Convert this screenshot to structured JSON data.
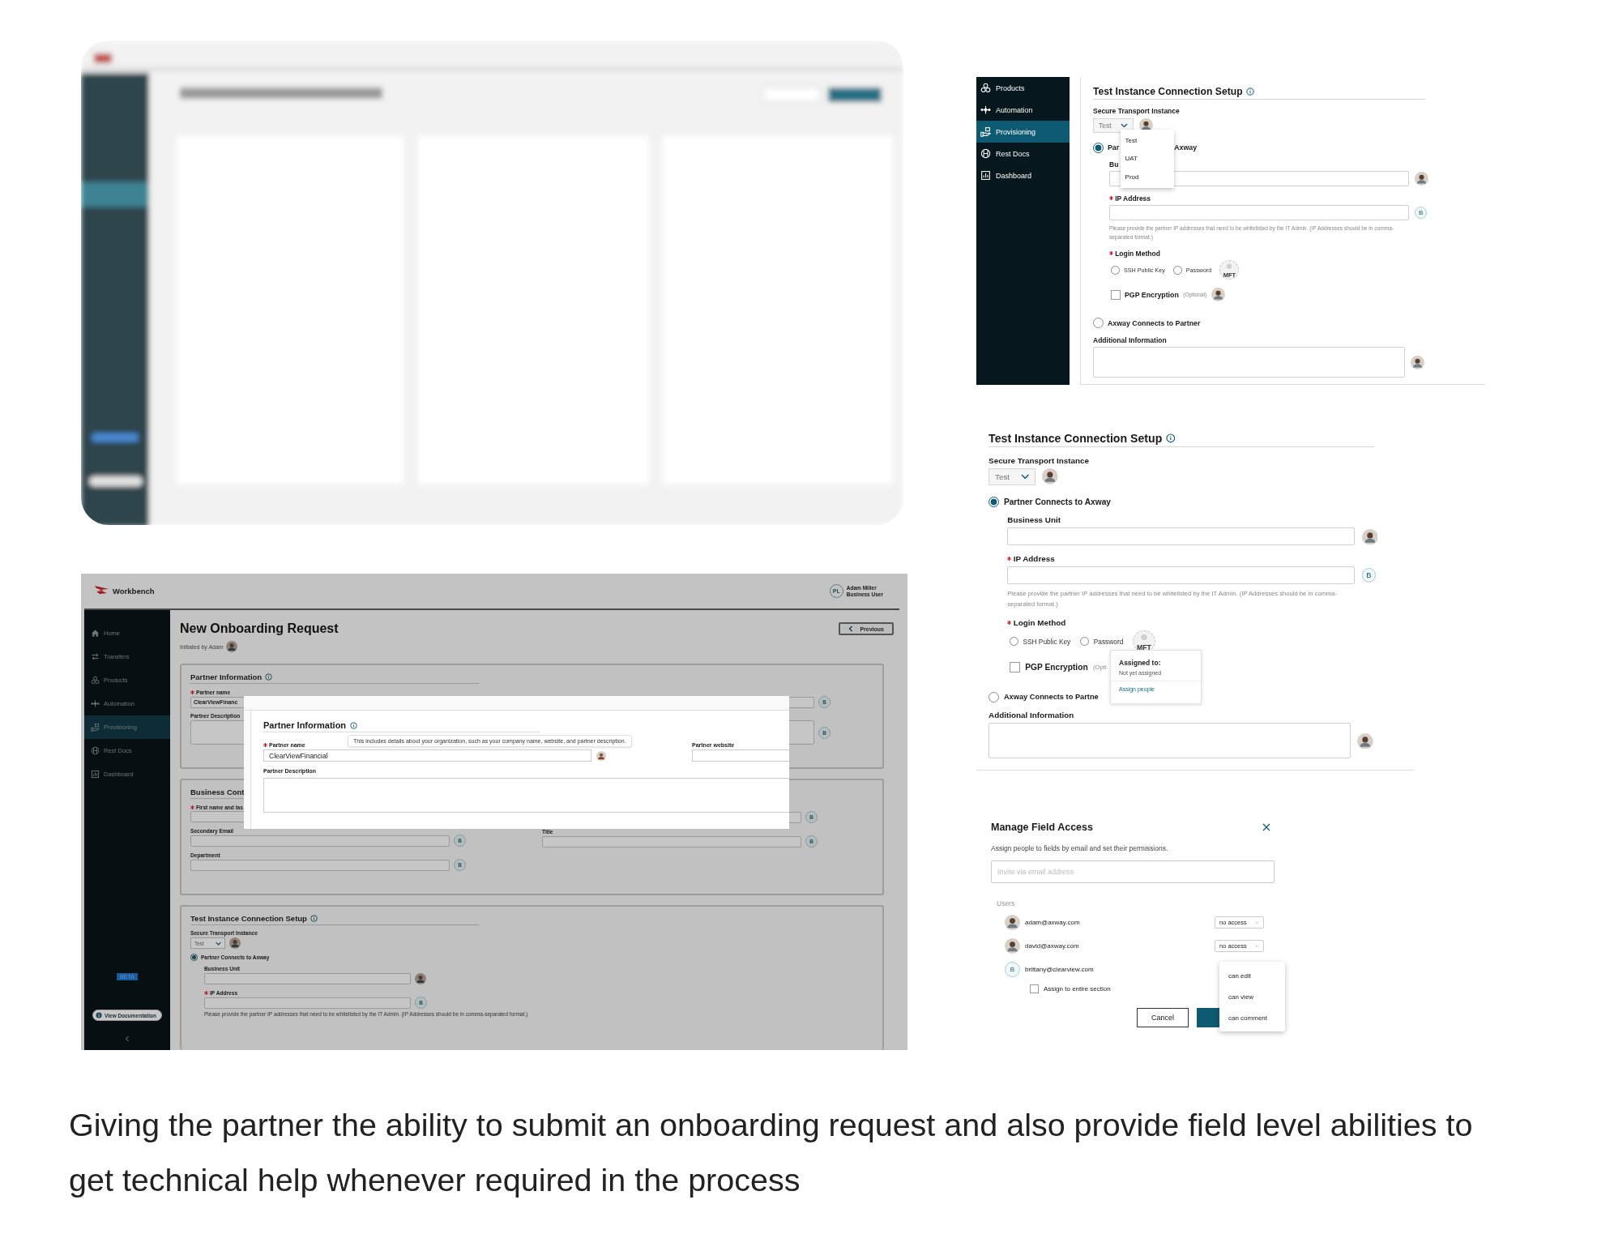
{
  "request_screen": {
    "brand": "Workbench",
    "user": {
      "initials": "PL",
      "name": "Adam Miller",
      "role": "Business User"
    },
    "nav": [
      {
        "label": "Home",
        "selected": false
      },
      {
        "label": "Transfers",
        "selected": false
      },
      {
        "label": "Products",
        "selected": false
      },
      {
        "label": "Automation",
        "selected": false
      },
      {
        "label": "Provisioning",
        "selected": true
      },
      {
        "label": "Rest Docs",
        "selected": false
      },
      {
        "label": "Dashboard",
        "selected": false
      }
    ],
    "badge": "BETA",
    "doc_button": "View Documentation",
    "title": "New Onboarding Request",
    "initiated": "Initiated by Adam",
    "previous": "Previous",
    "partner_card": {
      "title": "Partner Information",
      "name_label": {
        "text": "Partner name",
        "required": true
      },
      "name_value": "ClearViewFinanc",
      "name_assignee": "B",
      "desc_label": "Partner Description",
      "desc_assignee": "B"
    },
    "contact_card": {
      "title": "Business Cont",
      "fields_left": [
        {
          "label": "First name and las",
          "required": true
        },
        {
          "label": "Secondary Email",
          "assignee": "B"
        },
        {
          "label": "Department",
          "assignee": "B"
        }
      ],
      "fields_right": [
        {
          "assignee": "B"
        },
        {
          "label": "Title",
          "assignee": "B"
        }
      ]
    },
    "test_card": {
      "title": "Test Instance Connection Setup",
      "instance_label": "Secure Transport Instance",
      "instance_value": "Test",
      "option": {
        "label": "Partner Connects to Axway",
        "selected": true
      },
      "unit_label": "Business Unit",
      "ip_label": {
        "text": "IP Address",
        "required": true
      },
      "assignee": "B",
      "help": "Please provide the partner IP addresses that need to be whitelisted by the IT Admin. (IP Addresses should be in comma-separated format.)"
    },
    "modal": {
      "title": "Partner Information",
      "name_label": {
        "text": "Partner name",
        "required": true
      },
      "name_value": "ClearViewFinancial",
      "tooltip": "This includes details about your organization, such as your company name, website, and partner description.",
      "website_label": "Partner website",
      "desc_label": "Partner Description"
    }
  },
  "menu_panel": {
    "sidebar": [
      {
        "label": "Products",
        "selected": false
      },
      {
        "label": "Automation",
        "selected": false
      },
      {
        "label": "Provisioning",
        "selected": true
      },
      {
        "label": "Rest Docs",
        "selected": false
      },
      {
        "label": "Dashboard",
        "selected": false
      }
    ],
    "title": "Test Instance Connection Setup",
    "instance_label": "Secure Transport Instance",
    "instance_value": "Test",
    "menu": [
      "Test",
      "UAT",
      "Prod"
    ],
    "option_a": {
      "before": "Par",
      "after": "Axway",
      "selected": true
    },
    "unit_label": "Bu",
    "ip_label": {
      "text": "IP Address",
      "required": true
    },
    "ip_assignee": "B",
    "help": "Please provide the partner IP addresses that need to be whitelisted by the IT Admin. (IP Addresses should be in comma-separated format.)",
    "login_label": {
      "text": "Login Method",
      "required": true
    },
    "login_options": [
      {
        "label": "SSH Public Key",
        "selected": false
      },
      {
        "label": "Password",
        "selected": false
      }
    ],
    "mft": "MFT",
    "pgp": {
      "label": "PGP Encryption",
      "note": "(Optional)",
      "checked": false
    },
    "option_b": {
      "label": "Axway Connects to Partner",
      "selected": false
    },
    "additional_label": "Additional Information"
  },
  "assign_panel": {
    "title": "Test Instance Connection Setup",
    "instance_label": "Secure Transport Instance",
    "instance_value": "Test",
    "option_a": {
      "label": "Partner Connects to Axway",
      "selected": true
    },
    "unit_label": "Business Unit",
    "ip_label": {
      "text": "IP Address",
      "required": true
    },
    "ip_assignee": "B",
    "help": "Please provide the partner IP addresses that need to be whitelisted by the IT Admin. (IP Addresses should be in comma-separated format.)",
    "login_label": {
      "text": "Login Method",
      "required": true
    },
    "login_options": [
      {
        "label": "SSH Public Key",
        "selected": false
      },
      {
        "label": "Password",
        "selected": false
      }
    ],
    "mft": "MFT",
    "pgp": {
      "label": "PGP Encryption",
      "note": "(Opti",
      "checked": false
    },
    "option_b": {
      "label": "Axway Connects to Partne",
      "selected": false
    },
    "additional_label": "Additional Information",
    "popover": {
      "title": "Assigned to:",
      "status": "Not yet assigned",
      "link": "Assign people"
    }
  },
  "field_access": {
    "title": "Manage Field Access",
    "description": "Assign people to fields by email and set their permissions.",
    "placeholder": "Invite via email address",
    "users_label": "Users",
    "users": [
      {
        "email": "adam@axway.com",
        "access": "no access"
      },
      {
        "email": "david@axway.com",
        "access": "no access"
      },
      {
        "email": "brittany@clearview.com",
        "kind": "initial",
        "initial": "B"
      }
    ],
    "assign_all": {
      "label": "Assign to entire section",
      "checked": false
    },
    "access_menu": [
      "can edit",
      "can view",
      "can comment"
    ],
    "cancel": "Cancel"
  },
  "caption": "Giving the partner the ability to submit an onboarding request and also provide field level abilities to get technical help whenever required in the process"
}
